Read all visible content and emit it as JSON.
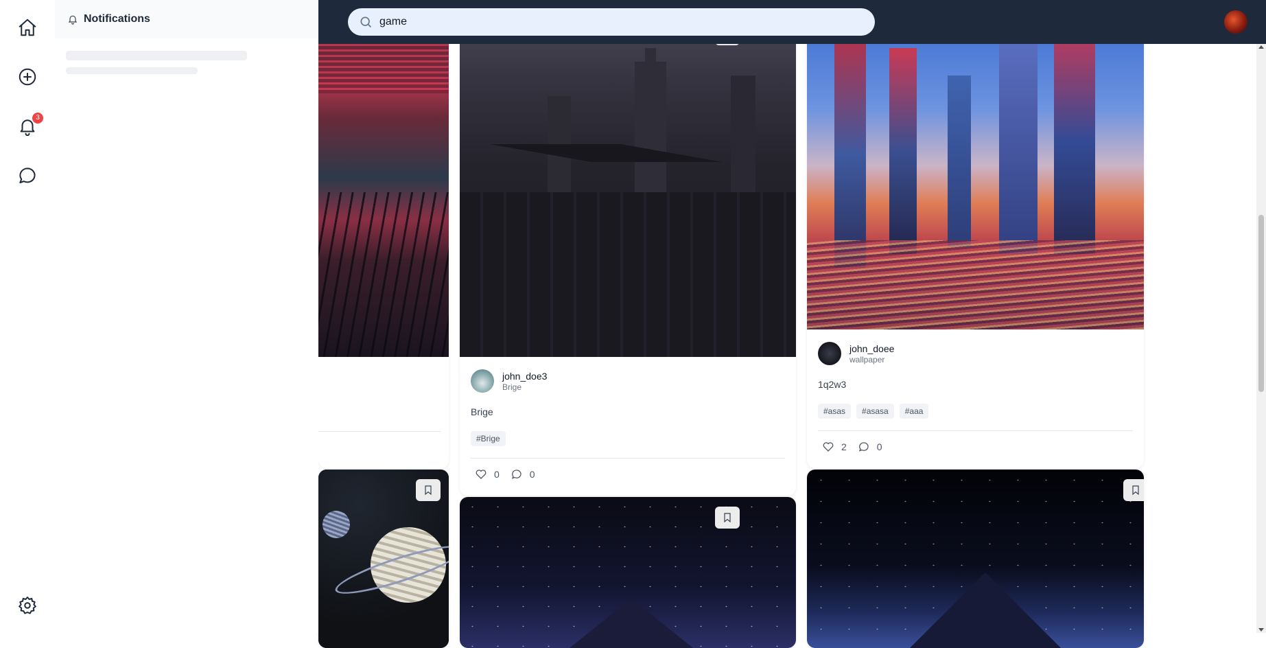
{
  "nav": {
    "notification_badge": "3"
  },
  "notifications": {
    "title": "Notifications"
  },
  "search": {
    "value": "game"
  },
  "posts": {
    "center": {
      "author": "john_doe3",
      "subtitle": "Brige",
      "description": "Brige",
      "tags": [
        "#Brige"
      ],
      "likes": "0",
      "comments": "0"
    },
    "right": {
      "author": "john_doee",
      "subtitle": "wallpaper",
      "description": "1q2w3",
      "tags": [
        "#asas",
        "#asasa",
        "#aaa"
      ],
      "likes": "2",
      "comments": "0"
    }
  },
  "colors": {
    "topbar": "#1e293b",
    "search_bg": "#e8f0fd",
    "badge": "#ef4444"
  }
}
